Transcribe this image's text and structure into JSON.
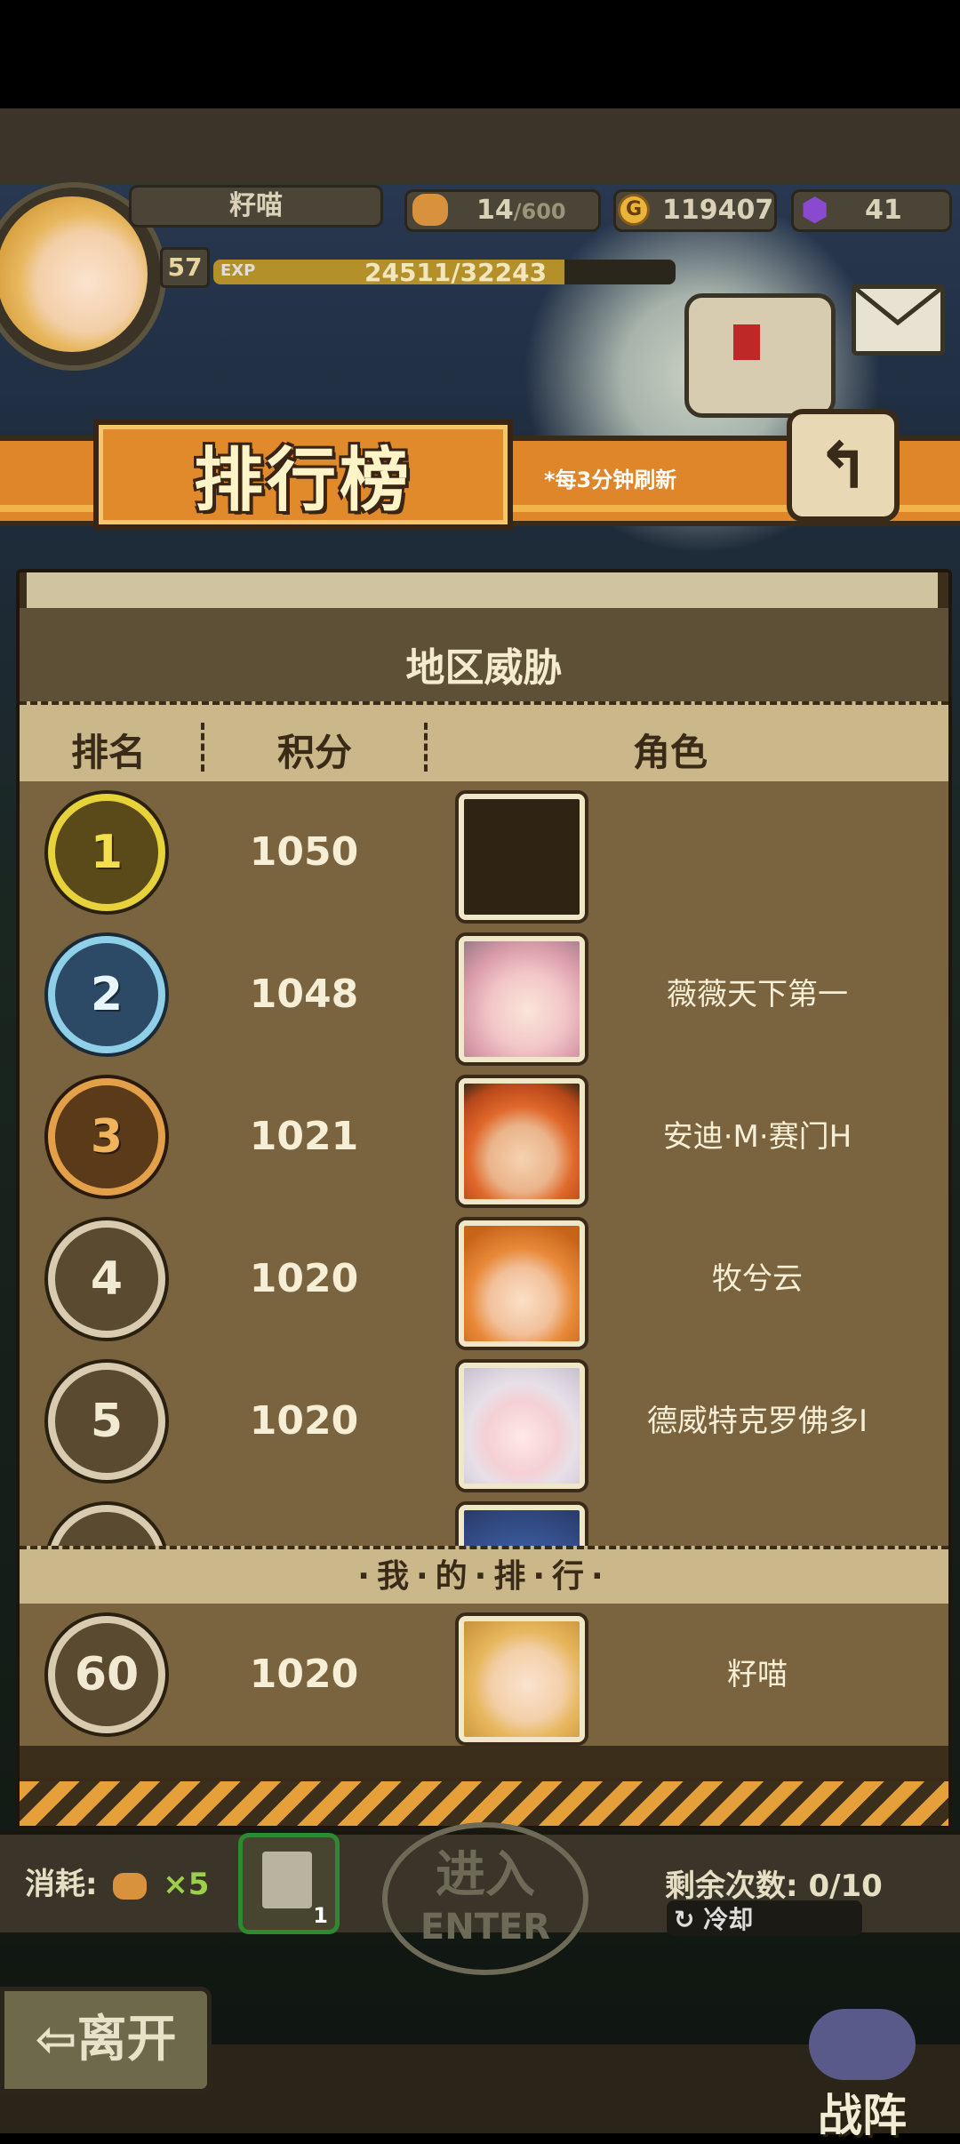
{
  "hud": {
    "player_name": "籽喵",
    "level": "57",
    "exp_label": "EXP",
    "exp_text": "24511/32243",
    "exp_progress": 0.76,
    "bread_current": "14",
    "bread_max": "/600",
    "gold": "119407",
    "gems": "41"
  },
  "banner": {
    "title": "排行榜",
    "note": "*每3分钟刷新"
  },
  "panel": {
    "header": "地区威胁",
    "columns": {
      "rank": "排名",
      "score": "积分",
      "role": "角色"
    },
    "rows": [
      {
        "rank": "1",
        "score": "1050",
        "name": ""
      },
      {
        "rank": "2",
        "score": "1048",
        "name": "薇薇天下第一"
      },
      {
        "rank": "3",
        "score": "1021",
        "name": "安迪·M·赛门H"
      },
      {
        "rank": "4",
        "score": "1020",
        "name": "牧兮云"
      },
      {
        "rank": "5",
        "score": "1020",
        "name": "德威特克罗佛多I"
      }
    ],
    "my_rank_title": "·我·的·排·行·",
    "my_rank": {
      "rank": "60",
      "score": "1020",
      "name": "籽喵"
    }
  },
  "bottom": {
    "consume_label": "消耗:",
    "consume_count": "×5",
    "ticket_count": "1",
    "enter_cn": "进入",
    "enter_en": "ENTER",
    "remain_label": "剩余次数:",
    "remain_value": "0/10",
    "cooldown": "冷却",
    "leave": "离开",
    "formation": "战阵"
  },
  "colors": {
    "accent_orange": "#e0862a",
    "panel_brown": "#7a6440",
    "gold_medal": "#e8d23a",
    "silver_medal": "#8fd0e8",
    "bronze_medal": "#e4a048"
  }
}
